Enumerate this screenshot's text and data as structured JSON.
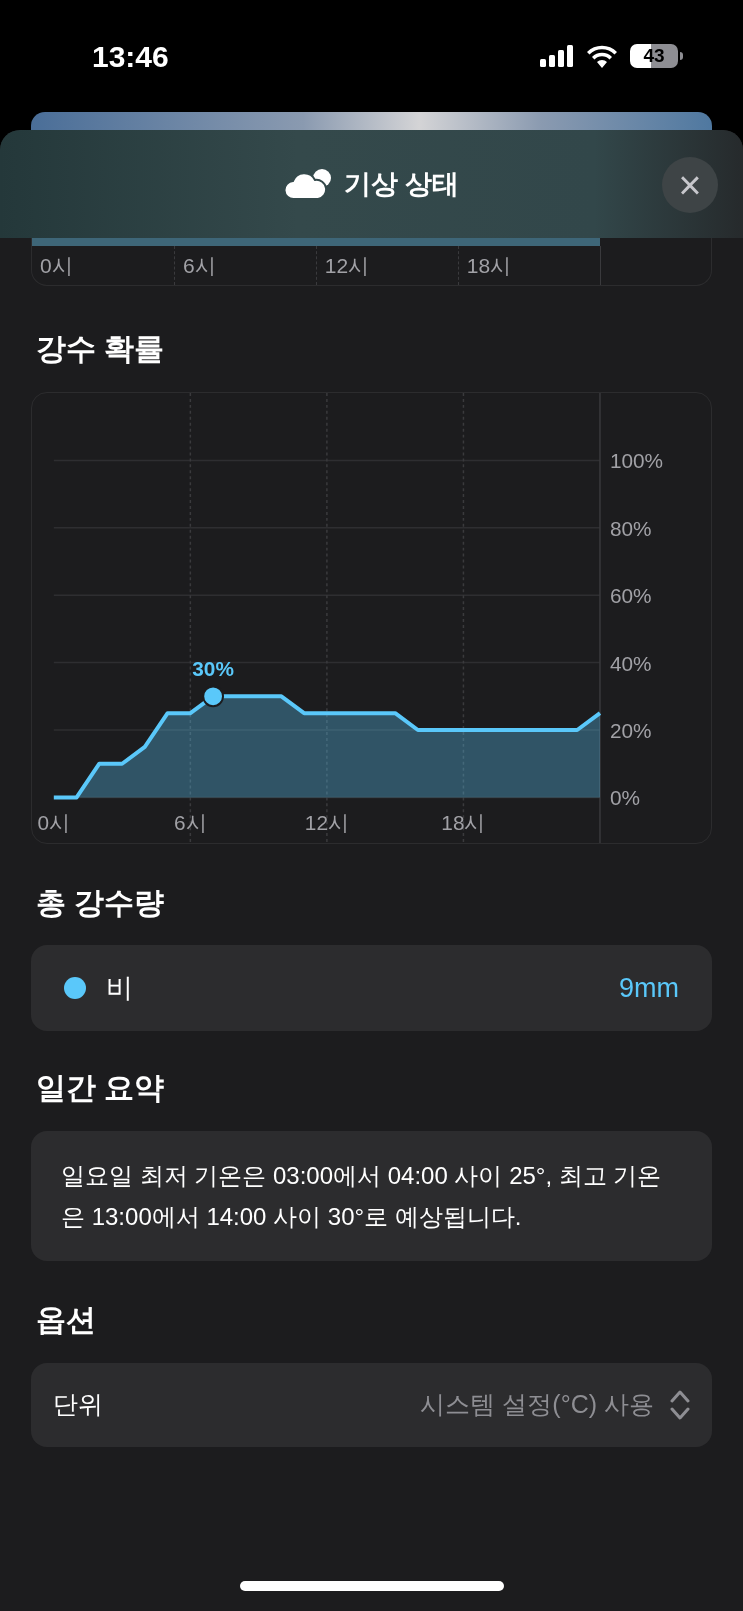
{
  "status_bar": {
    "time": "13:46",
    "battery": "43"
  },
  "sheet": {
    "title": "기상 상태",
    "close": "×"
  },
  "top_chart": {
    "x_labels": [
      "0시",
      "6시",
      "12시",
      "18시"
    ]
  },
  "precip_probability": {
    "heading": "강수 확률",
    "chart_data": {
      "type": "area",
      "x": [
        0,
        1,
        2,
        3,
        4,
        5,
        6,
        7,
        8,
        9,
        10,
        11,
        12,
        13,
        14,
        15,
        16,
        17,
        18,
        19,
        20,
        21,
        22,
        23,
        24
      ],
      "series": [
        {
          "color": "#5ac8fa",
          "values": [
            0,
            0,
            10,
            10,
            15,
            25,
            25,
            30,
            30,
            30,
            30,
            25,
            25,
            25,
            25,
            25,
            20,
            20,
            20,
            20,
            20,
            20,
            20,
            20,
            25
          ]
        }
      ],
      "xlim": [
        0,
        24
      ],
      "ylim": [
        0,
        120
      ],
      "grid": true,
      "xticks": [
        {
          "value": 0,
          "label": "0시"
        },
        {
          "value": 6,
          "label": "6시"
        },
        {
          "value": 12,
          "label": "12시"
        },
        {
          "value": 18,
          "label": "18시"
        }
      ],
      "yticks": [
        {
          "value": 0,
          "label": "0%"
        },
        {
          "value": 20,
          "label": "20%"
        },
        {
          "value": 40,
          "label": "40%"
        },
        {
          "value": 60,
          "label": "60%"
        },
        {
          "value": 80,
          "label": "80%"
        },
        {
          "value": 100,
          "label": "100%"
        }
      ],
      "annotations": [
        {
          "x": 7,
          "y": 30,
          "text": "30%"
        }
      ]
    }
  },
  "total_precip": {
    "heading": "총 강수량",
    "items": [
      {
        "label": "비",
        "value": "9mm",
        "color": "#5ac8fa"
      }
    ]
  },
  "daily_summary": {
    "heading": "일간 요약",
    "text": "일요일 최저 기온은 03:00에서 04:00 사이 25°, 최고 기온은 13:00에서 14:00 사이 30°로 예상됩니다."
  },
  "options": {
    "heading": "옵션",
    "rows": [
      {
        "label": "단위",
        "value": "시스템 설정(°C) 사용"
      }
    ]
  }
}
